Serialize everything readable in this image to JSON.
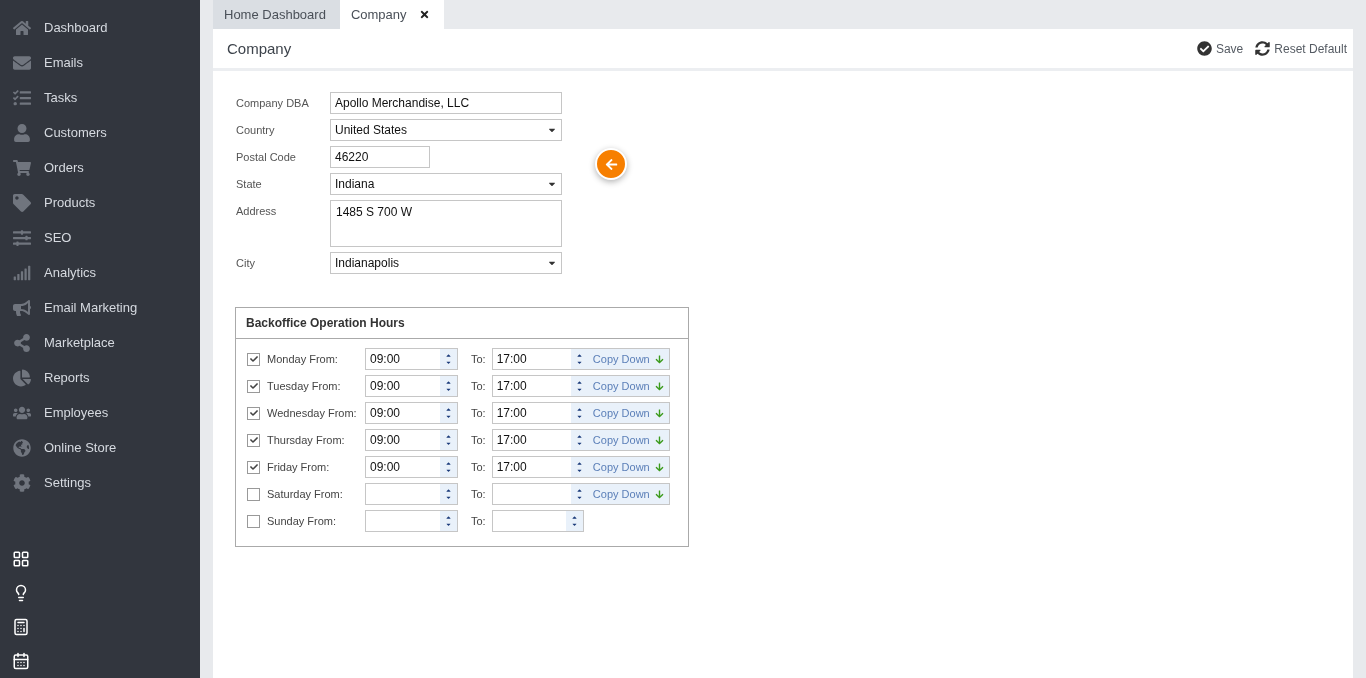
{
  "sidebar": {
    "items": [
      {
        "label": "Dashboard"
      },
      {
        "label": "Emails"
      },
      {
        "label": "Tasks"
      },
      {
        "label": "Customers"
      },
      {
        "label": "Orders"
      },
      {
        "label": "Products"
      },
      {
        "label": "SEO"
      },
      {
        "label": "Analytics"
      },
      {
        "label": "Email Marketing"
      },
      {
        "label": "Marketplace"
      },
      {
        "label": "Reports"
      },
      {
        "label": "Employees"
      },
      {
        "label": "Online Store"
      },
      {
        "label": "Settings"
      }
    ]
  },
  "tabs": [
    {
      "label": "Home Dashboard",
      "selected": false,
      "closable": false
    },
    {
      "label": "Company",
      "selected": true,
      "closable": true
    }
  ],
  "page": {
    "title": "Company",
    "actions": [
      "Save",
      "Reset Default"
    ]
  },
  "form": [
    {
      "kind": "text",
      "label": "Company DBA",
      "value": "Apollo Merchandise, LLC"
    },
    {
      "kind": "select",
      "label": "Country",
      "value": "United States"
    },
    {
      "kind": "short",
      "label": "Postal Code",
      "value": "46220"
    },
    {
      "kind": "select",
      "label": "State",
      "value": "Indiana"
    },
    {
      "kind": "textarea",
      "label": "Address",
      "value": "1485 S 700 W"
    },
    {
      "kind": "select",
      "label": "City",
      "value": "Indianapolis"
    }
  ],
  "hours": {
    "title": "Backoffice Operation Hours",
    "days": [
      {
        "label": "Monday From:",
        "checked": true,
        "from": "09:00",
        "to_label": "To:",
        "to": "17:00",
        "copy_down": "Copy Down"
      },
      {
        "label": "Tuesday From:",
        "checked": true,
        "from": "09:00",
        "to_label": "To:",
        "to": "17:00",
        "copy_down": "Copy Down"
      },
      {
        "label": "Wednesday From:",
        "checked": true,
        "from": "09:00",
        "to_label": "To:",
        "to": "17:00",
        "copy_down": "Copy Down"
      },
      {
        "label": "Thursday From:",
        "checked": true,
        "from": "09:00",
        "to_label": "To:",
        "to": "17:00",
        "copy_down": "Copy Down"
      },
      {
        "label": "Friday From:",
        "checked": true,
        "from": "09:00",
        "to_label": "To:",
        "to": "17:00",
        "copy_down": "Copy Down"
      },
      {
        "label": "Saturday From:",
        "checked": false,
        "to_label": "To:",
        "copy_down": "Copy Down"
      },
      {
        "label": "Sunday From:",
        "checked": false,
        "to_label": "To:"
      }
    ]
  }
}
